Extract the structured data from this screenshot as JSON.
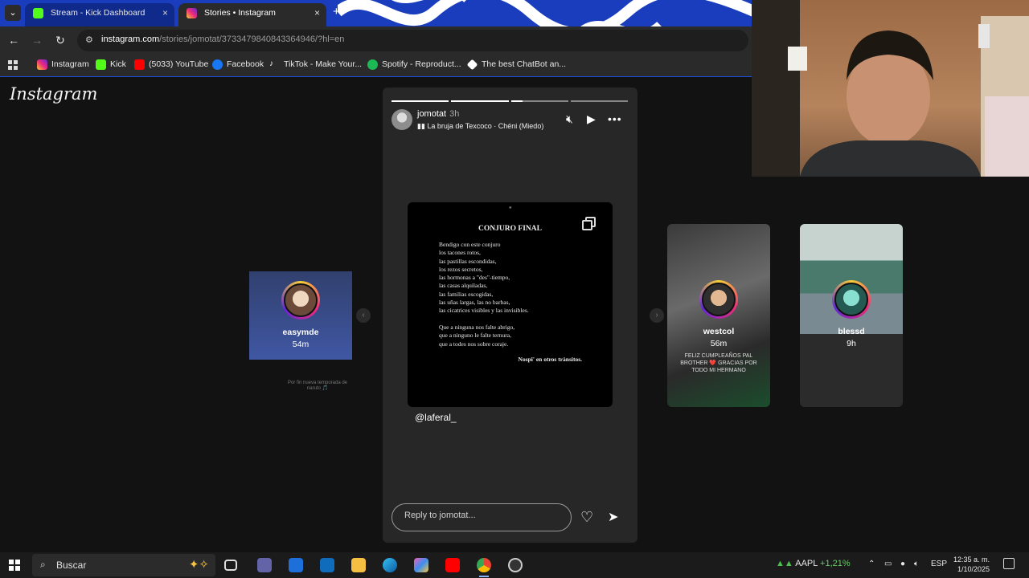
{
  "tabs": [
    {
      "label": "Stream - Kick Dashboard",
      "favicon_color": "#53fc18"
    },
    {
      "label": "Stories • Instagram",
      "favicon_color": "#e1306c"
    }
  ],
  "address": {
    "domain": "instagram.com",
    "path": "/stories/jomotat/3733479840843364946/?hl=en"
  },
  "bookmarks": [
    {
      "label": "Instagram",
      "color": "#e1306c"
    },
    {
      "label": "Kick",
      "color": "#53fc18"
    },
    {
      "label": "(5033) YouTube",
      "color": "#ff0000"
    },
    {
      "label": "Facebook",
      "color": "#1877f2"
    },
    {
      "label": "TikTok - Make Your...",
      "color": "#111111"
    },
    {
      "label": "Spotify - Reproduct...",
      "color": "#1db954"
    },
    {
      "label": "The best ChatBot an...",
      "color": "#ffffff"
    }
  ],
  "instagram": {
    "logo": "Instagram"
  },
  "story": {
    "username": "jomotat",
    "time": "3h",
    "song": "La bruja de Texcoco · Chéni (Miedo)",
    "post": {
      "quote": "\"",
      "title": "CONJURO FINAL",
      "poem": "Bendigo con este conjuro\nlos tacones rotos,\nlas pastillas escondidas,\nlos rezos secretos,\nlas hormonas a \"des\"-tiempo,\nlas casas alquiladas,\nlas familias escogidas,\nlas uñas largas, las no barbas,\nlas cicatrices visibles y las invisibles.\n\nQue a ninguna nos falte abrigo,\nque a ninguno le falte ternura,\nque a todes nos sobre coraje.",
      "signature": "Nospi' en otros tránsitos."
    },
    "mention": "@laferal_",
    "reply_placeholder": "Reply to jomotat..."
  },
  "side_stories": [
    {
      "name": "easymde",
      "time": "54m",
      "caption": "Por fin nueva temporada de naruto 🎵"
    },
    {
      "name": "westcol",
      "time": "56m",
      "caption": "FELIZ CUMPLEAÑOS PAL BROTHER ❤️ GRACIAS POR TODO MI HERMANO"
    },
    {
      "name": "blessd",
      "time": "9h"
    }
  ],
  "taskbar": {
    "search": "Buscar",
    "stock": "AAPL",
    "stock_change": "+1,21%",
    "lang": "ESP",
    "time": "12:35 a. m.",
    "date": "1/10/2025"
  }
}
